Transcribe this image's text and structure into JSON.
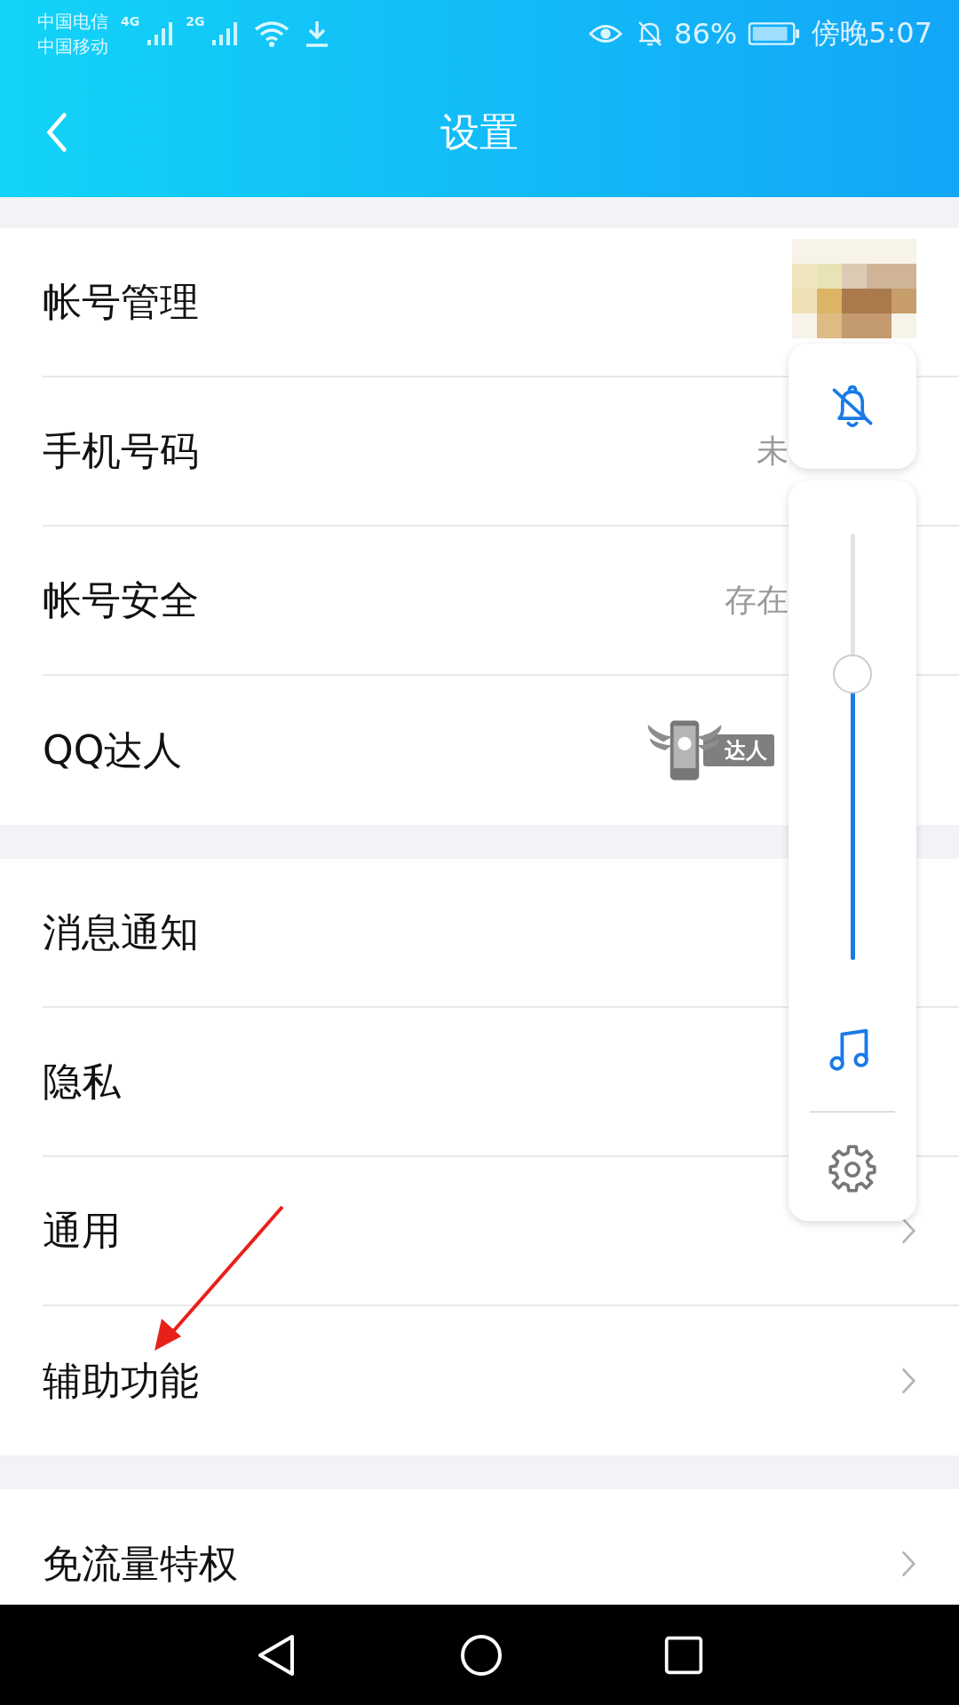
{
  "status_bar": {
    "carriers": [
      "中国电信",
      "中国移动"
    ],
    "networks": [
      "4G",
      "2G"
    ],
    "battery": "86%",
    "time": "傍晚5:07"
  },
  "header": {
    "title": "设置"
  },
  "sections": [
    {
      "rows": [
        {
          "label": "帐号管理",
          "kind": "avatar"
        },
        {
          "label": "手机号码",
          "kind": "value",
          "value": "未"
        },
        {
          "label": "帐号安全",
          "kind": "value",
          "value": "存在"
        },
        {
          "label": "QQ达人",
          "kind": "badge",
          "badge": "达人"
        }
      ]
    },
    {
      "rows": [
        {
          "label": "消息通知",
          "kind": "plain"
        },
        {
          "label": "隐私",
          "kind": "plain"
        },
        {
          "label": "通用",
          "kind": "plain",
          "chevron": true
        },
        {
          "label": "辅助功能",
          "kind": "plain",
          "chevron": true
        }
      ]
    },
    {
      "rows": [
        {
          "label": "免流量特权",
          "kind": "plain",
          "chevron": true
        }
      ]
    }
  ],
  "volume_panel": {
    "level": 0.67
  }
}
